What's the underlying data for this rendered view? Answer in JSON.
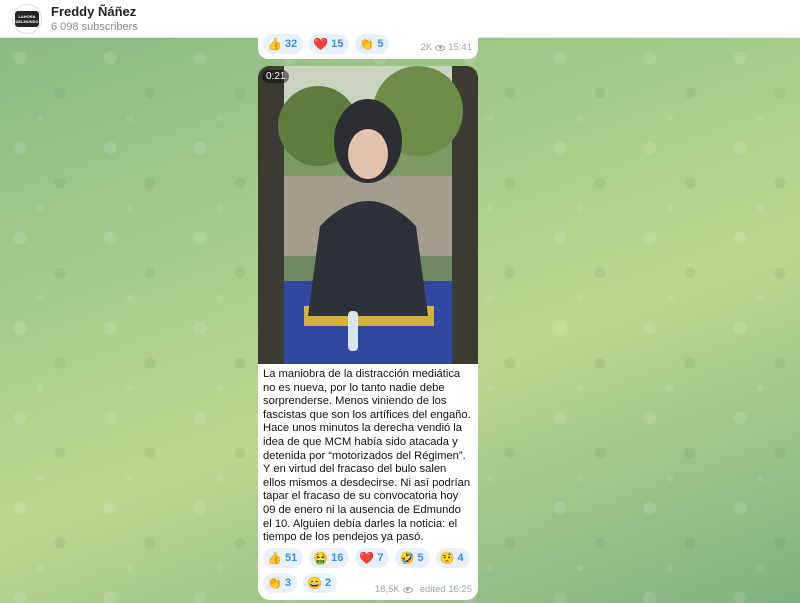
{
  "header": {
    "channel_name": "Freddy Ñáñez",
    "subscribers": "6 098 subscribers",
    "avatar_text": "LAHORA DELMUNDO"
  },
  "prev_message": {
    "reactions": [
      {
        "emoji_name": "thumbs-up-icon",
        "emoji": "👍",
        "count": "32"
      },
      {
        "emoji_name": "red-heart-icon",
        "emoji": "❤️",
        "count": "15"
      },
      {
        "emoji_name": "clapping-icon",
        "emoji": "👏",
        "count": "5"
      }
    ],
    "views": "2K",
    "time": "15:41"
  },
  "message": {
    "video_duration": "0:21",
    "text": "La maniobra de la distracción mediática no es nueva, por lo tanto nadie debe sorprenderse. Menos viniendo de los fascistas que son los artífices del engaño. Hace unos minutos la derecha vendió la idea de que MCM había sido atacada y detenida por “motorizados del Régimen”. Y en virtud del fracaso del bulo salen ellos mismos a desdecirse. Ni así podrían tapar el fracaso de su convocatoria hoy 09 de enero ni la ausencia de Edmundo el 10. Alguien debía darles la noticia: el tiempo de los pendejos ya pasó.",
    "reactions_row1": [
      {
        "emoji_name": "thumbs-up-icon",
        "emoji": "👍",
        "count": "51"
      },
      {
        "emoji_name": "vomiting-face-icon",
        "emoji": "🤮",
        "count": "16"
      },
      {
        "emoji_name": "red-heart-icon",
        "emoji": "❤️",
        "count": "7"
      },
      {
        "emoji_name": "rolling-laughing-icon",
        "emoji": "🤣",
        "count": "5"
      },
      {
        "emoji_name": "raised-eyebrow-icon",
        "emoji": "🤨",
        "count": "4"
      }
    ],
    "reactions_row2": [
      {
        "emoji_name": "clapping-icon",
        "emoji": "👏",
        "count": "3"
      },
      {
        "emoji_name": "grinning-face-icon",
        "emoji": "😄",
        "count": "2"
      }
    ],
    "views": "18,5K",
    "edited": "edited 16:25"
  }
}
